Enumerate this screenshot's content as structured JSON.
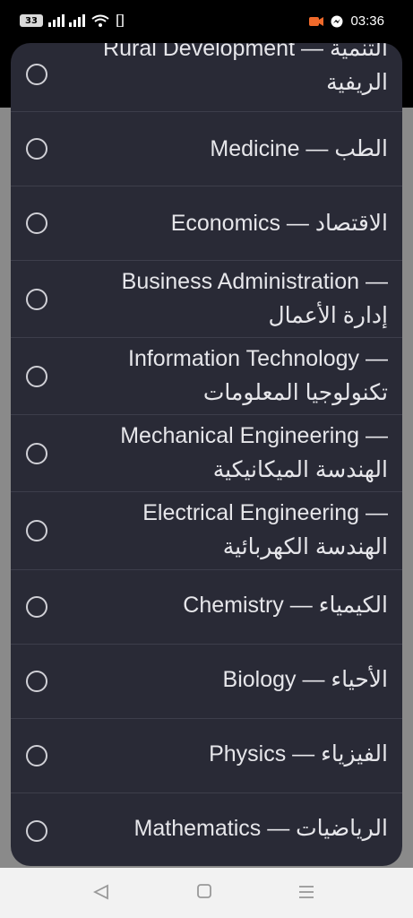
{
  "status": {
    "battery": "33",
    "time": "03:36"
  },
  "items": [
    {
      "line1": "Rural Development — التنمية",
      "line2": "الريفية"
    },
    {
      "line1": "Medicine — الطب",
      "line2": ""
    },
    {
      "line1": "Economics — الاقتصاد",
      "line2": ""
    },
    {
      "line1": "Business Administration —",
      "line2": "إدارة الأعمال"
    },
    {
      "line1": "Information Technology —",
      "line2": "تكنولوجيا المعلومات"
    },
    {
      "line1": "Mechanical Engineering —",
      "line2": "الهندسة الميكانيكية"
    },
    {
      "line1": "Electrical Engineering —",
      "line2": "الهندسة الكهربائية"
    },
    {
      "line1": "Chemistry — الكيمياء",
      "line2": ""
    },
    {
      "line1": "Biology — الأحياء",
      "line2": ""
    },
    {
      "line1": "Physics — الفيزياء",
      "line2": ""
    },
    {
      "line1": "Mathematics — الرياضيات",
      "line2": ""
    }
  ],
  "icons": {
    "radio": "radio-unchecked",
    "nav_back": "triangle-back",
    "nav_home": "square-home",
    "nav_recent": "menu-recent"
  }
}
